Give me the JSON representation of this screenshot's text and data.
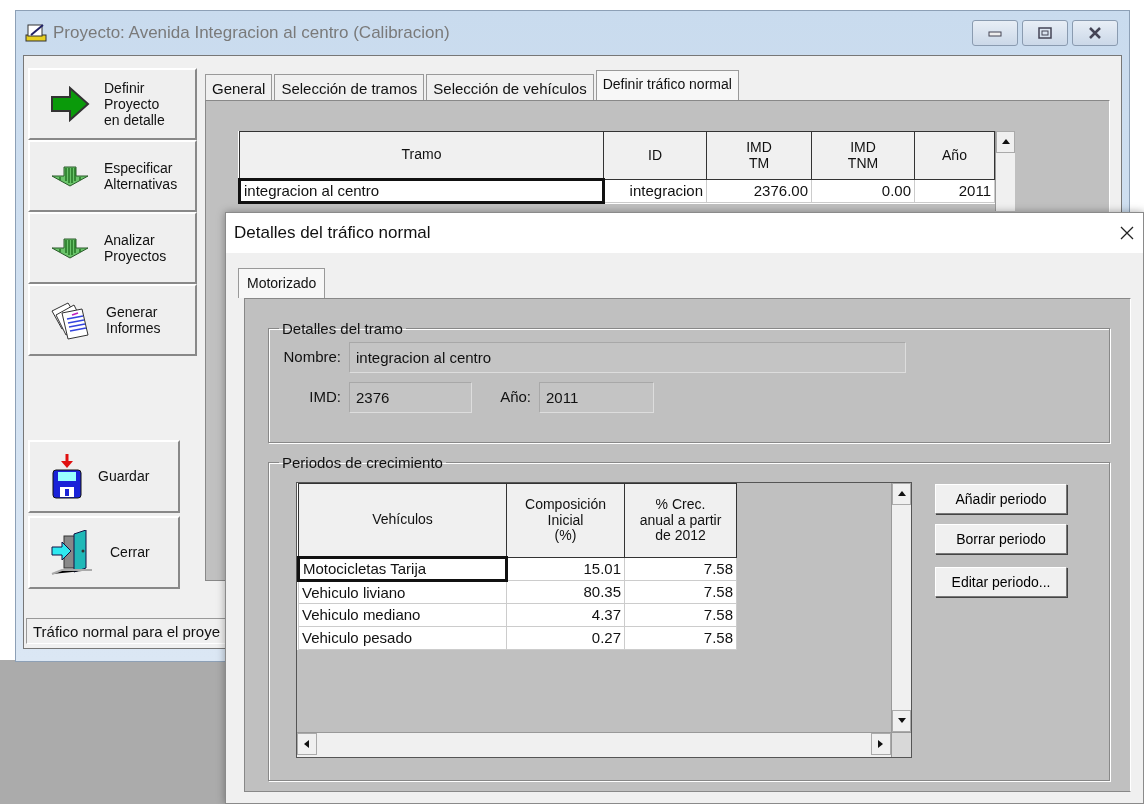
{
  "main_window": {
    "title": "Proyecto: Avenida Integracion al centro (Calibracion)",
    "nav_buttons": [
      {
        "label": "Definir\nProyecto\nen detalle",
        "kind": "arrow"
      },
      {
        "label": "Especificar\nAlternativas",
        "kind": "down-arrows"
      },
      {
        "label": "Analizar\nProyectos",
        "kind": "down-arrows"
      },
      {
        "label": "Generar\nInformes",
        "kind": "documents"
      }
    ],
    "action_buttons": [
      {
        "label": "Guardar",
        "kind": "save"
      },
      {
        "label": "Cerrar",
        "kind": "exit"
      }
    ],
    "tabs": [
      {
        "label": "General",
        "selected": false
      },
      {
        "label": "Selección de tramos",
        "selected": false
      },
      {
        "label": "Selección de vehículos",
        "selected": false
      },
      {
        "label": "Definir tráfico normal",
        "selected": true
      }
    ],
    "table": {
      "columns": [
        "Tramo",
        "ID",
        "IMD\nTM",
        "IMD\nTNM",
        "Año"
      ],
      "rows": [
        {
          "cells": [
            {
              "text": "integracion al centro",
              "focused": true
            },
            {
              "text": "integracion",
              "focused": false
            },
            {
              "text": "2376.00",
              "focused": false
            },
            {
              "text": "0.00",
              "focused": false
            },
            {
              "text": "2011",
              "focused": false
            }
          ]
        }
      ]
    },
    "status_bar": "Tráfico normal para el proye"
  },
  "dialog": {
    "title": "Detalles del tráfico normal",
    "tabs": [
      {
        "label": "Motorizado",
        "selected": true
      }
    ],
    "section_details": {
      "title": "Detalles del tramo",
      "name_label": "Nombre:",
      "name_value": "integracion al centro",
      "imd_label": "IMD:",
      "imd_value": "2376",
      "year_label": "Año:",
      "year_value": "2011"
    },
    "section_periods": {
      "title": "Periodos de crecimiento",
      "table": {
        "columns": [
          "Vehículos",
          "Composición\nInicial\n(%)",
          "% Crec.\nanual a partir\nde 2012"
        ],
        "rows": [
          {
            "cells": [
              {
                "text": "Motocicletas Tarija",
                "focused": true
              },
              {
                "text": "15.01",
                "focused": false
              },
              {
                "text": "7.58",
                "focused": false
              }
            ]
          },
          {
            "cells": [
              {
                "text": "Vehiculo liviano",
                "focused": false
              },
              {
                "text": "80.35",
                "focused": false
              },
              {
                "text": "7.58",
                "focused": false
              }
            ]
          },
          {
            "cells": [
              {
                "text": "Vehiculo mediano",
                "focused": false
              },
              {
                "text": "4.37",
                "focused": false
              },
              {
                "text": "7.58",
                "focused": false
              }
            ]
          },
          {
            "cells": [
              {
                "text": "Vehiculo pesado",
                "focused": false
              },
              {
                "text": "0.27",
                "focused": false
              },
              {
                "text": "7.58",
                "focused": false
              }
            ]
          }
        ]
      },
      "buttons": [
        "Añadir periodo",
        "Borrar periodo",
        "Editar periodo..."
      ]
    }
  }
}
